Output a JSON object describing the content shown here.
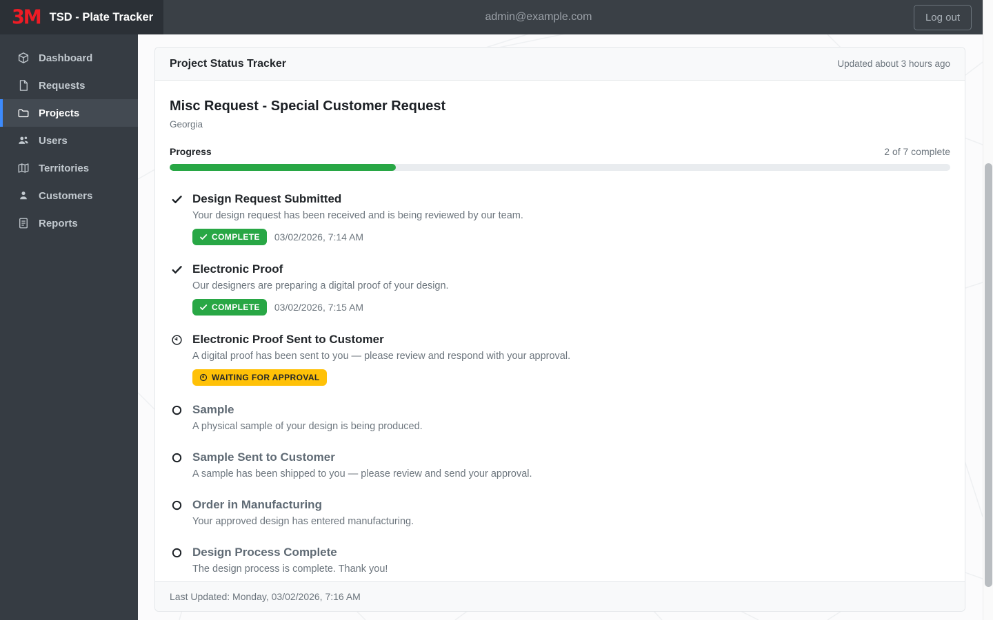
{
  "topbar": {
    "brand_logo": "3M",
    "brand_title": "TSD - Plate Tracker",
    "user_email": "admin@example.com",
    "logout_label": "Log out"
  },
  "sidebar": {
    "items": [
      {
        "label": "Dashboard",
        "icon": "cube-icon",
        "active": false
      },
      {
        "label": "Requests",
        "icon": "file-icon",
        "active": false
      },
      {
        "label": "Projects",
        "icon": "folder-icon",
        "active": true
      },
      {
        "label": "Users",
        "icon": "users-icon",
        "active": false
      },
      {
        "label": "Territories",
        "icon": "map-icon",
        "active": false
      },
      {
        "label": "Customers",
        "icon": "person-icon",
        "active": false
      },
      {
        "label": "Reports",
        "icon": "report-icon",
        "active": false
      }
    ]
  },
  "card": {
    "header_title": "Project Status Tracker",
    "updated_text": "Updated about 3 hours ago",
    "project_title": "Misc Request - Special Customer Request",
    "project_subtitle": "Georgia",
    "progress": {
      "label": "Progress",
      "summary": "2 of 7 complete",
      "percent": 29
    },
    "steps": [
      {
        "title": "Design Request Submitted",
        "description": "Your design request has been received and is being reviewed by our team.",
        "status": "complete",
        "icon": "check-icon",
        "badge_label": "COMPLETE",
        "timestamp": "03/02/2026, 7:14 AM"
      },
      {
        "title": "Electronic Proof",
        "description": "Our designers are preparing a digital proof of your design.",
        "status": "complete",
        "icon": "check-icon",
        "badge_label": "COMPLETE",
        "timestamp": "03/02/2026, 7:15 AM"
      },
      {
        "title": "Electronic Proof Sent to Customer",
        "description": "A digital proof has been sent to you — please review and respond with your approval.",
        "status": "waiting",
        "icon": "clock-icon",
        "badge_label": "WAITING FOR APPROVAL",
        "timestamp": ""
      },
      {
        "title": "Sample",
        "description": "A physical sample of your design is being produced.",
        "status": "pending",
        "icon": "circle-icon",
        "badge_label": "",
        "timestamp": ""
      },
      {
        "title": "Sample Sent to Customer",
        "description": "A sample has been shipped to you — please review and send your approval.",
        "status": "pending",
        "icon": "circle-icon",
        "badge_label": "",
        "timestamp": ""
      },
      {
        "title": "Order in Manufacturing",
        "description": "Your approved design has entered manufacturing.",
        "status": "pending",
        "icon": "circle-icon",
        "badge_label": "",
        "timestamp": ""
      },
      {
        "title": "Design Process Complete",
        "description": "The design process is complete. Thank you!",
        "status": "pending",
        "icon": "circle-icon",
        "badge_label": "",
        "timestamp": ""
      }
    ],
    "footer_text": "Last Updated: Monday, 03/02/2026, 7:16 AM"
  },
  "colors": {
    "brand_red": "#ee1c25",
    "accent_blue": "#3d8bfd",
    "success_green": "#28a745",
    "warning_yellow": "#ffc107"
  }
}
